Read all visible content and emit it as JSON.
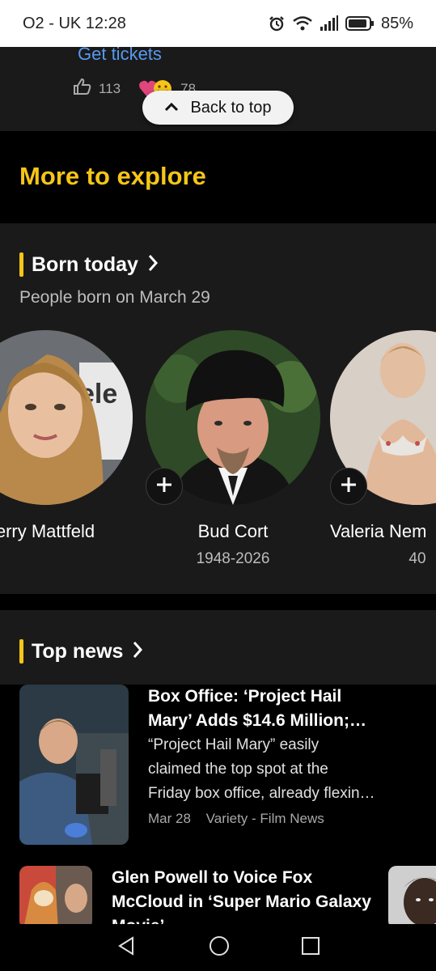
{
  "status": {
    "carrier_time": "O2 - UK 12:28",
    "battery": "85%"
  },
  "previous": {
    "link": "Get tickets",
    "likes": "113",
    "reactions": "78"
  },
  "back_to_top": "Back to top",
  "explore": {
    "title": "More to explore"
  },
  "born_today": {
    "title": "Born today",
    "subtitle": "People born on March 29",
    "people": [
      {
        "name": "erry Mattfeld",
        "years": ""
      },
      {
        "name": "Bud Cort",
        "years": "1948-2026"
      },
      {
        "name": "Valeria Nem",
        "years": "40"
      }
    ]
  },
  "top_news": {
    "title": "Top news",
    "items": [
      {
        "title_line1": "Box Office: ‘Project Hail",
        "title_line2": "Mary’ Adds $14.6 Million;…",
        "body_line1": "“Project Hail Mary” easily",
        "body_line2": "claimed the top spot at the",
        "body_line3": "Friday box office, already flexin…",
        "date": "Mar 28",
        "source": "Variety - Film News"
      },
      {
        "title_line1": "Glen Powell to Voice Fox",
        "title_line2": "McCloud in ‘Super Mario Galaxy",
        "title_line3": "Movie’"
      }
    ]
  },
  "colors": {
    "accent": "#f5c518",
    "link": "#5799ef",
    "section_bg": "#1a1a1a"
  },
  "icons": [
    "alarm-icon",
    "wifi-icon",
    "signal-icon",
    "battery-icon",
    "thumbs-up-icon",
    "heart-emoji-icon",
    "chevron-up-icon",
    "chevron-right-icon",
    "add-icon",
    "back-nav-icon",
    "home-nav-icon",
    "recents-nav-icon"
  ]
}
